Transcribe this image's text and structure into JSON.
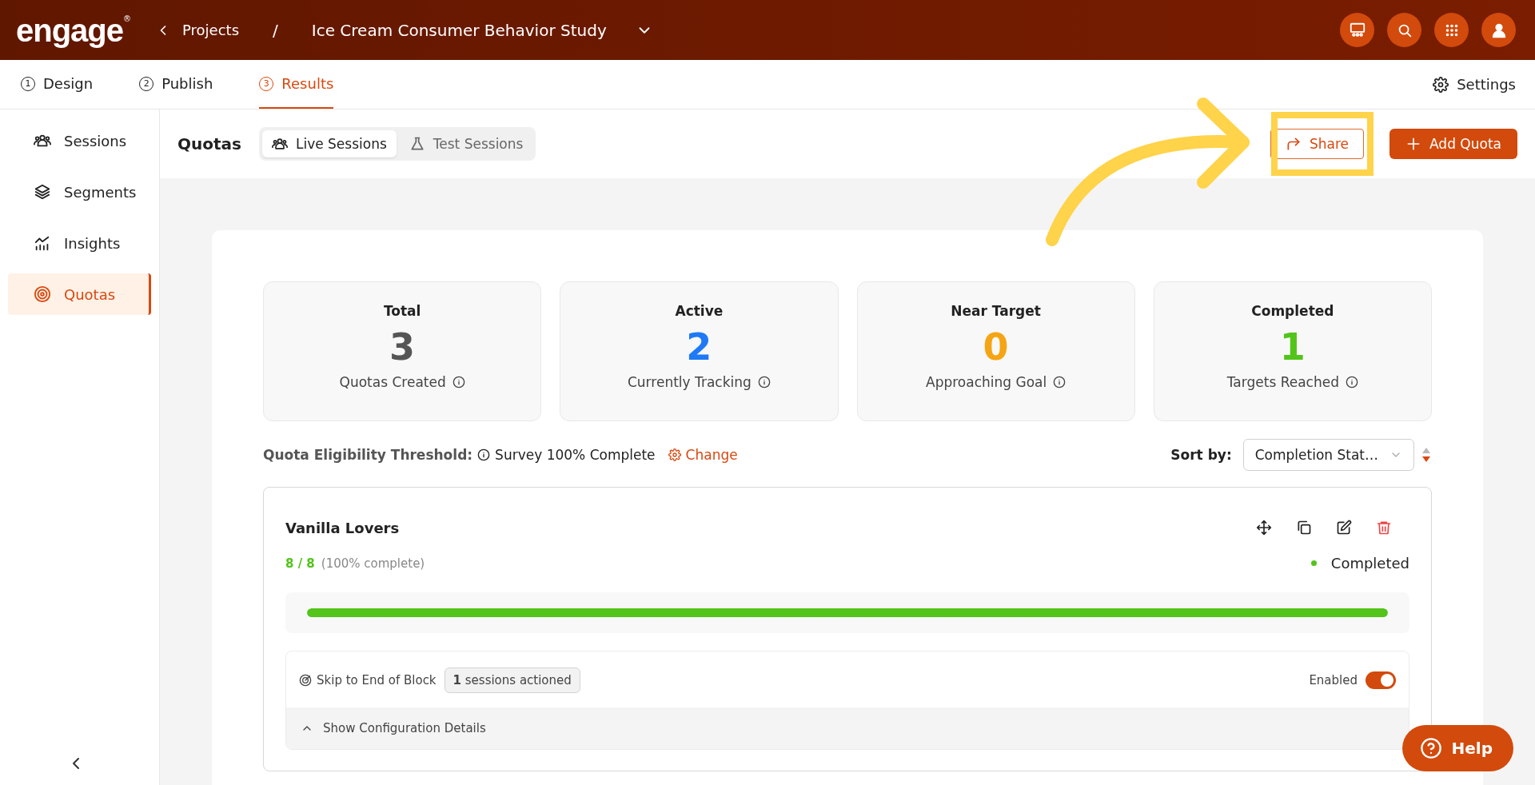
{
  "header": {
    "logo": "engage",
    "logo_mark": "®",
    "back": "Projects",
    "separator": "/",
    "project": "Ice Cream Consumer Behavior Study"
  },
  "steps": [
    {
      "number": "1",
      "label": "Design",
      "selected": false
    },
    {
      "number": "2",
      "label": "Publish",
      "selected": false
    },
    {
      "number": "3",
      "label": "Results",
      "selected": true
    }
  ],
  "settings": "Settings",
  "sidebar": {
    "items": [
      {
        "label": "Sessions",
        "selected": false
      },
      {
        "label": "Segments",
        "selected": false
      },
      {
        "label": "Insights",
        "selected": false
      },
      {
        "label": "Quotas",
        "selected": true
      }
    ]
  },
  "toolbar": {
    "title": "Quotas",
    "session_tabs": [
      {
        "label": "Live Sessions",
        "selected": true
      },
      {
        "label": "Test Sessions",
        "selected": false
      }
    ],
    "share": "Share",
    "add": "Add Quota"
  },
  "stats": [
    {
      "title": "Total",
      "value": "3",
      "caption": "Quotas Created",
      "color": "#555555"
    },
    {
      "title": "Active",
      "value": "2",
      "caption": "Currently Tracking",
      "color": "#1f7af5"
    },
    {
      "title": "Near Target",
      "value": "0",
      "caption": "Approaching Goal",
      "color": "#f5a514"
    },
    {
      "title": "Completed",
      "value": "1",
      "caption": "Targets Reached",
      "color": "#52c41a"
    }
  ],
  "threshold": {
    "label": "Quota Eligibility Threshold:",
    "value": "Survey 100% Complete",
    "change": "Change"
  },
  "sort": {
    "label": "Sort by:",
    "value": "Completion Stat…"
  },
  "quotas": [
    {
      "name": "Vanilla Lovers",
      "count": "8 / 8",
      "percent": "(100% complete)",
      "status": "Completed",
      "color": "#52c41a",
      "level": 1,
      "action": "Skip to End of Block",
      "sessions": "**1** sessions actioned",
      "toggle_label": "Enabled",
      "enabled": true,
      "details": "Show Configuration Details"
    }
  ],
  "help": "Help"
}
